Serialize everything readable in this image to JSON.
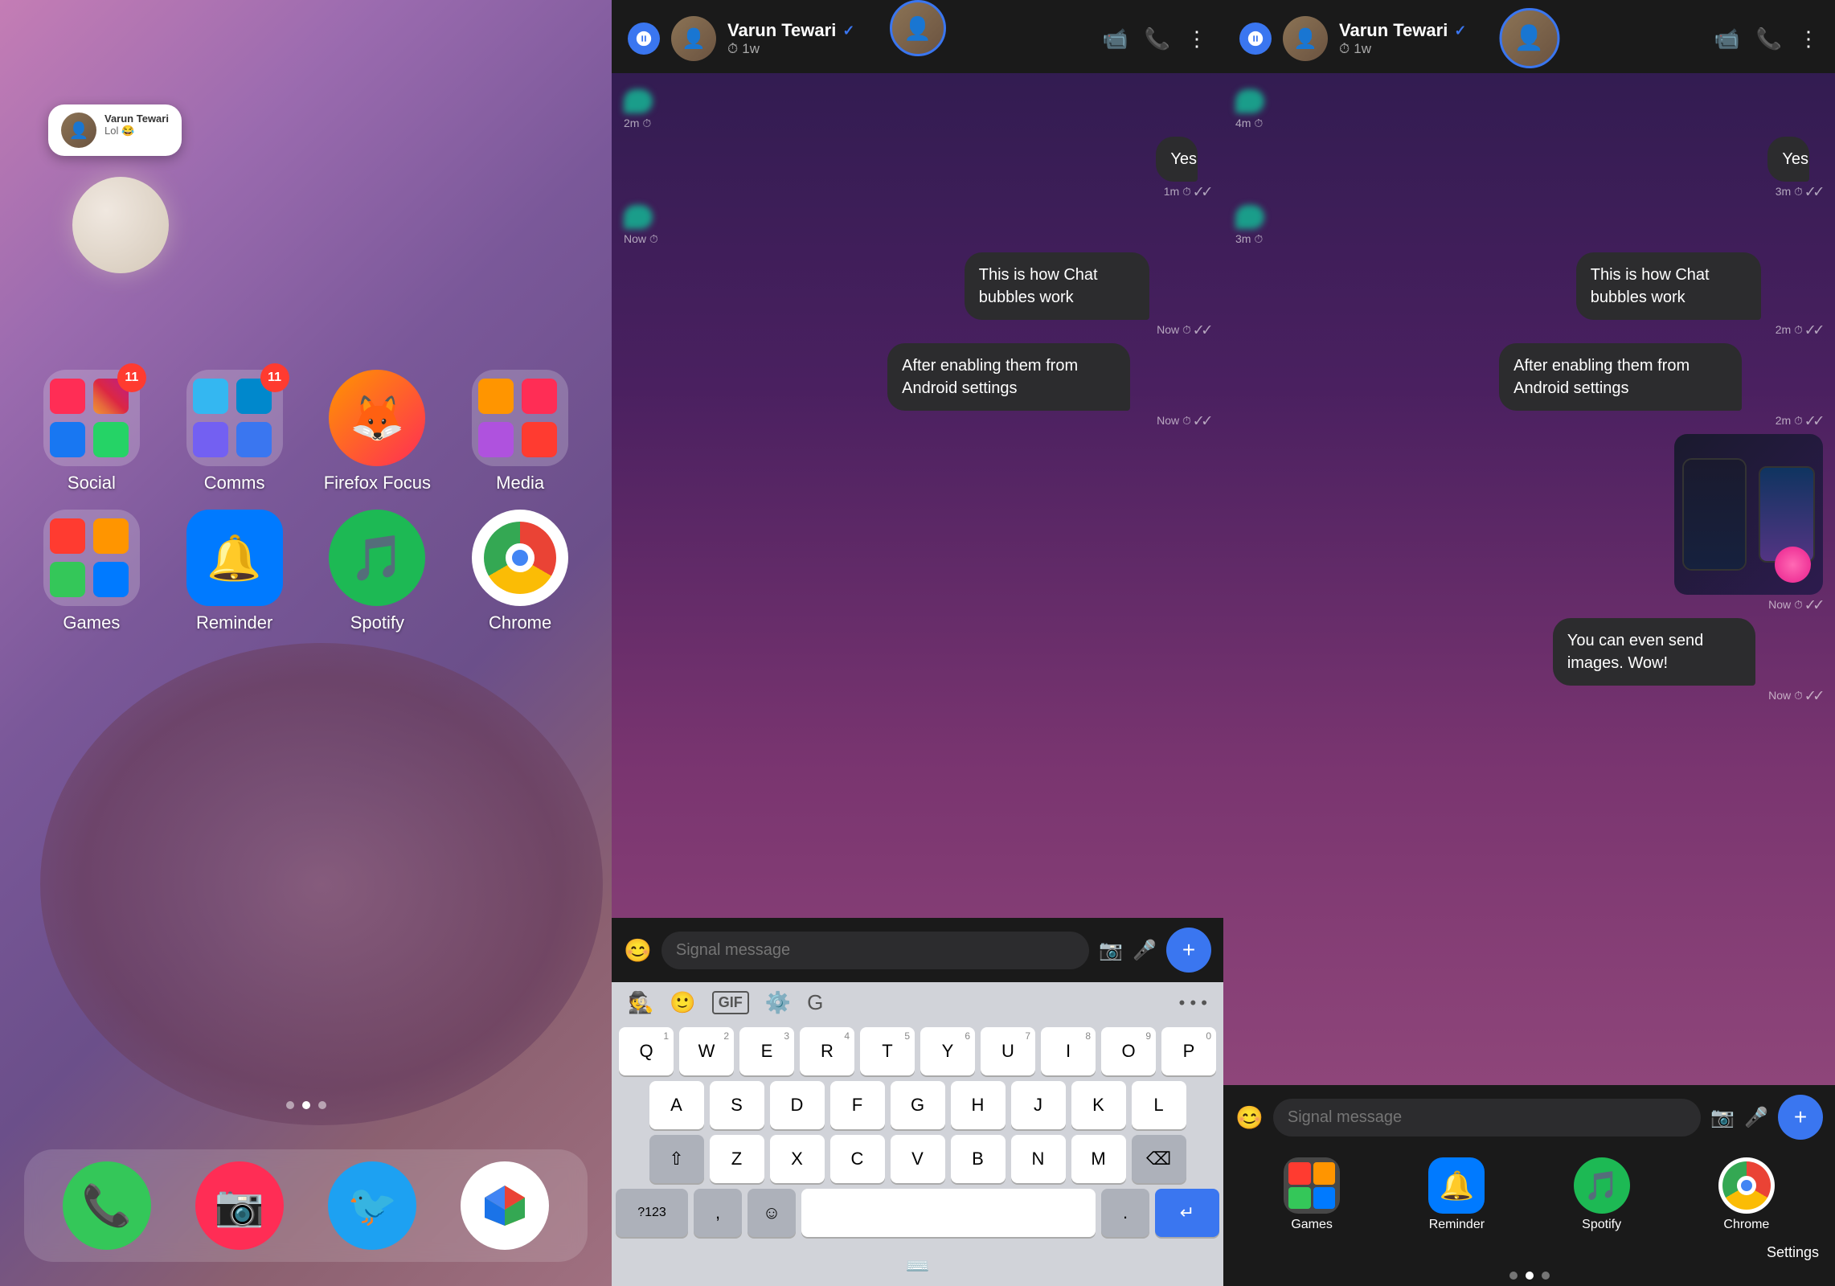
{
  "left": {
    "notification": {
      "name": "Varun Tewari",
      "message": "Lol 😂"
    },
    "apps_row1": [
      {
        "id": "social",
        "label": "Social",
        "badge": "11",
        "type": "folder"
      },
      {
        "id": "comms",
        "label": "Comms",
        "badge": "11",
        "type": "folder"
      },
      {
        "id": "firefox",
        "label": "Firefox Focus",
        "badge": null,
        "type": "app"
      },
      {
        "id": "media",
        "label": "Media",
        "badge": null,
        "type": "folder"
      }
    ],
    "apps_row2": [
      {
        "id": "games",
        "label": "Games",
        "badge": null,
        "type": "folder"
      },
      {
        "id": "reminder",
        "label": "Reminder",
        "badge": null,
        "type": "app"
      },
      {
        "id": "spotify",
        "label": "Spotify",
        "badge": null,
        "type": "app"
      },
      {
        "id": "chrome",
        "label": "Chrome",
        "badge": null,
        "type": "app"
      }
    ],
    "dock": [
      {
        "id": "phone",
        "label": "Phone"
      },
      {
        "id": "camera",
        "label": "Camera"
      },
      {
        "id": "twitter",
        "label": "Twitter"
      },
      {
        "id": "maps",
        "label": "Maps"
      }
    ]
  },
  "middle": {
    "header": {
      "contact": "Varun Tewari",
      "time_ago": "1w",
      "verified": true
    },
    "messages": [
      {
        "id": "m1",
        "type": "received",
        "time": "2m ⏱",
        "has_content": true
      },
      {
        "id": "m2",
        "type": "sent",
        "text": "Yes",
        "time": "1m ⏱ ✓✓"
      },
      {
        "id": "m3",
        "type": "received",
        "time": "Now ⏱",
        "has_content": true
      },
      {
        "id": "m4",
        "type": "sent",
        "text": "This is how Chat bubbles work",
        "time": "Now ⏱ ✓✓"
      },
      {
        "id": "m5",
        "type": "sent",
        "text": "After enabling them from Android settings",
        "time": "Now ⏱ ✓✓"
      }
    ],
    "input_placeholder": "Signal message",
    "keyboard": {
      "rows": [
        [
          "Q",
          "W",
          "E",
          "R",
          "T",
          "Y",
          "U",
          "I",
          "O",
          "P"
        ],
        [
          "A",
          "S",
          "D",
          "F",
          "G",
          "H",
          "J",
          "K",
          "L"
        ],
        [
          "⇧",
          "Z",
          "X",
          "C",
          "V",
          "B",
          "N",
          "M",
          "⌫"
        ],
        [
          "?123",
          ",",
          "☺",
          "",
          ".",
          "↵"
        ]
      ],
      "num_hints": [
        "1",
        "2",
        "3",
        "4",
        "5",
        "6",
        "7",
        "8",
        "9",
        "0"
      ]
    }
  },
  "right": {
    "header": {
      "contact": "Varun Tewari",
      "time_ago": "1w",
      "verified": true
    },
    "messages": [
      {
        "id": "r1",
        "type": "received",
        "time": "4m ⏱",
        "has_content": true
      },
      {
        "id": "r2",
        "type": "sent",
        "text": "Yes",
        "time": "3m ⏱ ✓✓"
      },
      {
        "id": "r3",
        "type": "received",
        "time": "3m ⏱",
        "has_content": true
      },
      {
        "id": "r4",
        "type": "sent",
        "text": "This is how Chat bubbles work",
        "time": "2m ⏱ ✓✓"
      },
      {
        "id": "r5",
        "type": "sent",
        "text": "After enabling them from Android settings",
        "time": "2m ⏱ ✓✓"
      },
      {
        "id": "r6",
        "type": "image",
        "time": "Now ⏱ ✓✓"
      },
      {
        "id": "r7",
        "type": "sent",
        "text": "You can even send images. Wow!",
        "time": "Now ⏱ ✓✓"
      }
    ],
    "input_placeholder": "Signal message",
    "settings_label": "Settings",
    "dock_labels": [
      "Games",
      "Reminder",
      "Spotify",
      "Chrome"
    ]
  }
}
